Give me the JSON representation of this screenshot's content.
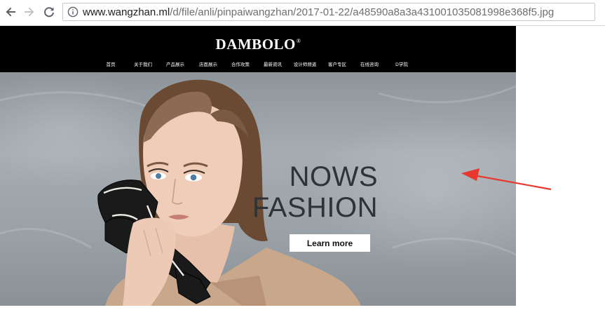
{
  "browser": {
    "url_prefix": "www.wangzhan.ml",
    "url_path": "/d/file/anli/pinpaiwangzhan/2017-01-22/a48590a8a3a431001035081998e368f5.jpg",
    "back_icon": "back-arrow-icon",
    "forward_icon": "forward-arrow-icon",
    "reload_icon": "reload-icon",
    "info_icon": "info-icon"
  },
  "site": {
    "logo": "DAMBOLO",
    "logo_mark": "®",
    "nav": [
      "首页",
      "关于我们",
      "产品展示",
      "店面展示",
      "合作攻策",
      "最新资讯",
      "设计师频道",
      "客户专区",
      "在线咨询",
      "D学院"
    ],
    "hero": {
      "title_line1": "NOWS",
      "title_line2": "FASHION",
      "cta_label": "Learn more"
    }
  },
  "colors": {
    "header_bg": "#000000",
    "annotation_arrow": "#e8372f"
  }
}
